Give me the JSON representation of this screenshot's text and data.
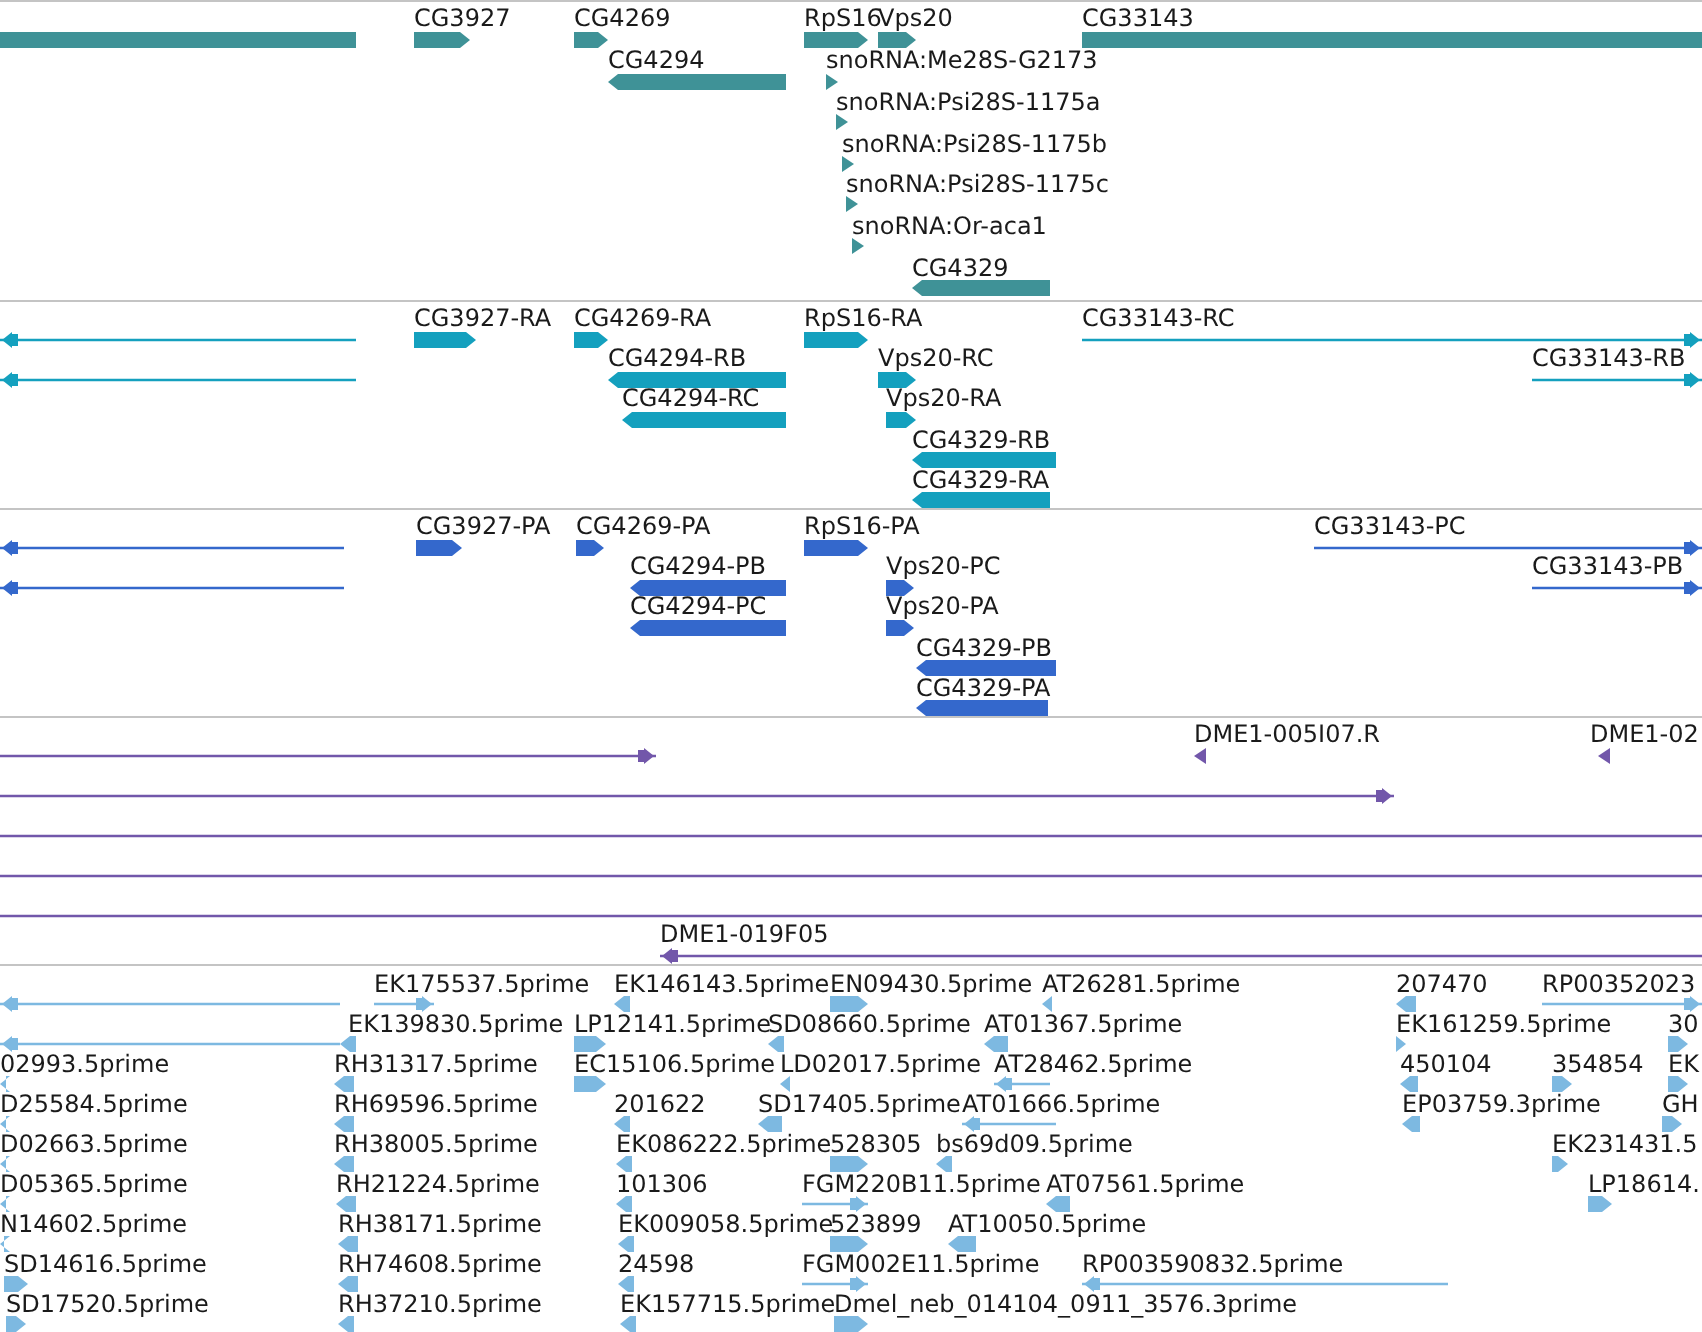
{
  "tracks": [
    {
      "color": "#3f9297",
      "features": [
        {
          "kind": "plain"
        },
        {
          "label": "CG3927",
          "kind": "forward"
        },
        {
          "label": "CG4269",
          "kind": "forward"
        },
        {
          "label": "CG4294",
          "kind": "reverse"
        },
        {
          "label": "RpS16",
          "kind": "forward"
        },
        {
          "label": "Vps20",
          "kind": "forward"
        },
        {
          "label": "CG33143",
          "kind": "plain"
        },
        {
          "label": "snoRNA:Me28S-G2173",
          "kind": "forward"
        },
        {
          "label": "snoRNA:Psi28S-1175a",
          "kind": "forward"
        },
        {
          "label": "snoRNA:Psi28S-1175b",
          "kind": "forward"
        },
        {
          "label": "snoRNA:Psi28S-1175c",
          "kind": "forward"
        },
        {
          "label": "snoRNA:Or-aca1",
          "kind": "forward"
        },
        {
          "label": "CG4329",
          "kind": "reverse"
        }
      ]
    },
    {
      "color": "#14a0be",
      "features": [
        {
          "kind": "reverse"
        },
        {
          "kind": "reverse"
        },
        {
          "label": "CG3927-RA",
          "kind": "forward"
        },
        {
          "label": "CG4269-RA",
          "kind": "forward"
        },
        {
          "label": "CG4294-RB",
          "kind": "reverse"
        },
        {
          "label": "CG4294-RC",
          "kind": "reverse"
        },
        {
          "label": "RpS16-RA",
          "kind": "forward"
        },
        {
          "label": "Vps20-RC",
          "kind": "forward"
        },
        {
          "label": "Vps20-RA",
          "kind": "forward"
        },
        {
          "label": "CG4329-RB",
          "kind": "reverse"
        },
        {
          "label": "CG4329-RA",
          "kind": "reverse"
        },
        {
          "label": "CG33143-RC",
          "kind": "forward"
        },
        {
          "label": "CG33143-RB",
          "kind": "forward"
        }
      ]
    },
    {
      "color": "#3468cc",
      "features": [
        {
          "kind": "reverse"
        },
        {
          "kind": "reverse"
        },
        {
          "label": "CG3927-PA",
          "kind": "forward"
        },
        {
          "label": "CG4269-PA",
          "kind": "forward"
        },
        {
          "label": "CG4294-PB",
          "kind": "reverse"
        },
        {
          "label": "CG4294-PC",
          "kind": "reverse"
        },
        {
          "label": "RpS16-PA",
          "kind": "forward"
        },
        {
          "label": "Vps20-PC",
          "kind": "forward"
        },
        {
          "label": "Vps20-PA",
          "kind": "forward"
        },
        {
          "label": "CG4329-PB",
          "kind": "reverse"
        },
        {
          "label": "CG4329-PA",
          "kind": "reverse"
        },
        {
          "label": "CG33143-PC",
          "kind": "forward"
        },
        {
          "label": "CG33143-PB",
          "kind": "forward"
        }
      ]
    },
    {
      "color": "#7257aa",
      "features": [
        {
          "kind": "forward"
        },
        {
          "label": "DME1-005I07.R",
          "kind": "reverse"
        },
        {
          "label": "DME1-02",
          "kind": "reverse"
        },
        {
          "kind": "forward"
        },
        {
          "kind": "plain"
        },
        {
          "kind": "plain"
        },
        {
          "kind": "plain"
        },
        {
          "label": "DME1-019F05",
          "kind": "reverse"
        }
      ]
    },
    {
      "color": "#7db9e1",
      "features": [
        {
          "kind": "reverse"
        },
        {
          "kind": "reverse"
        },
        {
          "label": "EK175537.5prime",
          "kind": "forward"
        },
        {
          "label": "EK146143.5prime",
          "kind": "reverse"
        },
        {
          "label": "EN09430.5prime",
          "kind": "forward"
        },
        {
          "label": "AT26281.5prime",
          "kind": "reverse"
        },
        {
          "label": "207470",
          "kind": "reverse"
        },
        {
          "label": "RP00352023",
          "kind": "forward"
        },
        {
          "label": "EK139830.5prime",
          "kind": "reverse"
        },
        {
          "label": "LP12141.5prime",
          "kind": "forward"
        },
        {
          "label": "SD08660.5prime",
          "kind": "reverse"
        },
        {
          "label": "AT01367.5prime",
          "kind": "reverse"
        },
        {
          "label": "EK161259.5prime",
          "kind": "forward"
        },
        {
          "label": "30",
          "kind": "forward"
        },
        {
          "label": "02993.5prime",
          "kind": "reverse"
        },
        {
          "label": "RH31317.5prime",
          "kind": "reverse"
        },
        {
          "label": "EC15106.5prime",
          "kind": "forward"
        },
        {
          "label": "LD02017.5prime",
          "kind": "reverse"
        },
        {
          "label": "AT28462.5prime",
          "kind": "reverse"
        },
        {
          "label": "450104",
          "kind": "reverse"
        },
        {
          "label": "354854",
          "kind": "forward"
        },
        {
          "label": "EK",
          "kind": "forward"
        },
        {
          "label": "D25584.5prime",
          "kind": "reverse"
        },
        {
          "label": "RH69596.5prime",
          "kind": "reverse"
        },
        {
          "label": "201622",
          "kind": "reverse"
        },
        {
          "label": "SD17405.5prime",
          "kind": "reverse"
        },
        {
          "label": "AT01666.5prime",
          "kind": "reverse"
        },
        {
          "label": "EP03759.3prime",
          "kind": "reverse"
        },
        {
          "label": "GH",
          "kind": "forward"
        },
        {
          "label": "D02663.5prime",
          "kind": "reverse"
        },
        {
          "label": "RH38005.5prime",
          "kind": "reverse"
        },
        {
          "label": "EK086222.5prime",
          "kind": "reverse"
        },
        {
          "label": "528305",
          "kind": "forward"
        },
        {
          "label": "bs69d09.5prime",
          "kind": "reverse"
        },
        {
          "label": "EK231431.5",
          "kind": "forward"
        },
        {
          "label": "D05365.5prime",
          "kind": "reverse"
        },
        {
          "label": "RH21224.5prime",
          "kind": "reverse"
        },
        {
          "label": "101306",
          "kind": "reverse"
        },
        {
          "label": "FGM220B11.5prime",
          "kind": "forward"
        },
        {
          "label": "AT07561.5prime",
          "kind": "reverse"
        },
        {
          "label": "LP18614.",
          "kind": "forward"
        },
        {
          "label": "N14602.5prime",
          "kind": "reverse"
        },
        {
          "label": "RH38171.5prime",
          "kind": "reverse"
        },
        {
          "label": "EK009058.5prime",
          "kind": "reverse"
        },
        {
          "label": "523899",
          "kind": "forward"
        },
        {
          "label": "AT10050.5prime",
          "kind": "reverse"
        },
        {
          "label": "SD14616.5prime",
          "kind": "forward"
        },
        {
          "label": "RH74608.5prime",
          "kind": "reverse"
        },
        {
          "label": "24598",
          "kind": "reverse"
        },
        {
          "label": "FGM002E11.5prime",
          "kind": "forward"
        },
        {
          "label": "RP003590832.5prime",
          "kind": "reverse"
        },
        {
          "label": "SD17520.5prime",
          "kind": "forward"
        },
        {
          "label": "RH37210.5prime",
          "kind": "reverse"
        },
        {
          "label": "EK157715.5prime",
          "kind": "reverse"
        },
        {
          "label": "Dmel_neb_014104_0911_3576.3prime",
          "kind": "forward"
        }
      ]
    }
  ]
}
